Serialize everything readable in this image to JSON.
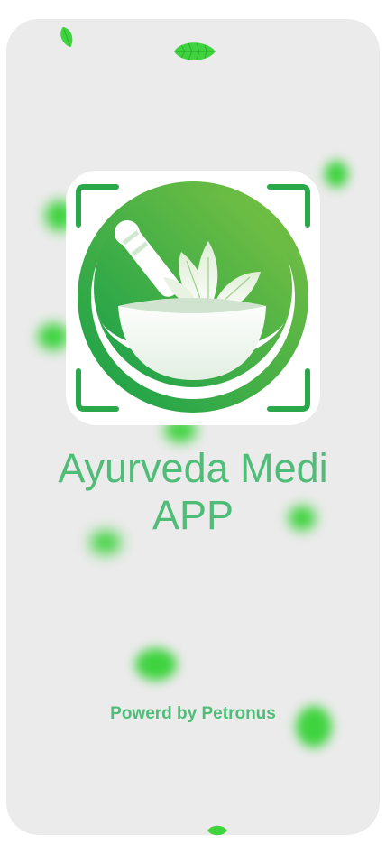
{
  "splash": {
    "app_name_line1": "Ayurveda Medi",
    "app_name_line2": "APP",
    "powered_by": "Powerd by Petronus"
  },
  "logo": {
    "icon": "mortar-pestle-herb-leaves-icon"
  },
  "decorations": {
    "icon": "falling-leaf-icon"
  },
  "colors": {
    "background": "#ebebeb",
    "card": "#ffffff",
    "brand_green": "#2aa84a",
    "light_green": "#7dc242",
    "text_green": "#4fbc77",
    "leaf_green": "#3fd33f"
  }
}
